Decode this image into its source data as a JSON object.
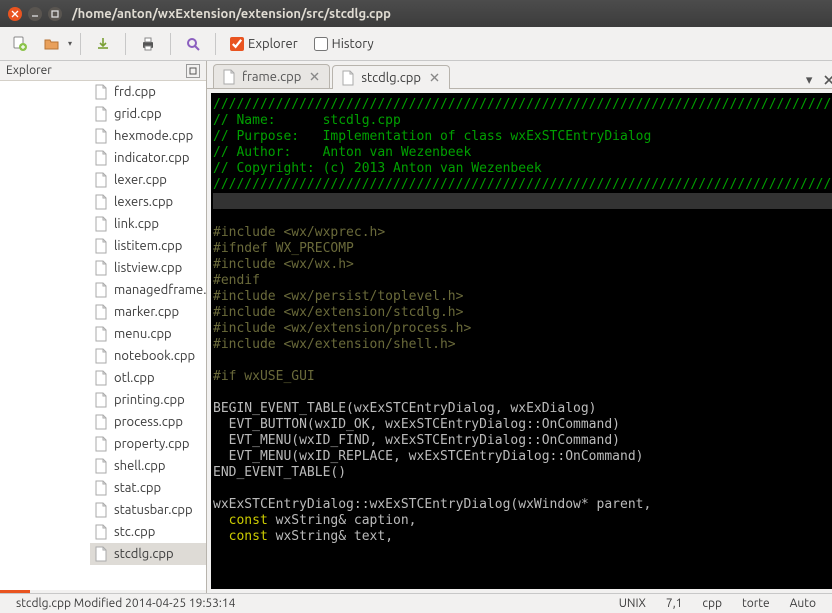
{
  "window": {
    "title": "/home/anton/wxExtension/extension/src/stcdlg.cpp"
  },
  "toolbar": {
    "explorer_label": "Explorer",
    "history_label": "History",
    "explorer_checked": true,
    "history_checked": false
  },
  "explorer": {
    "title": "Explorer",
    "files": [
      "frd.cpp",
      "grid.cpp",
      "hexmode.cpp",
      "indicator.cpp",
      "lexer.cpp",
      "lexers.cpp",
      "link.cpp",
      "listitem.cpp",
      "listview.cpp",
      "managedframe.cpp",
      "marker.cpp",
      "menu.cpp",
      "notebook.cpp",
      "otl.cpp",
      "printing.cpp",
      "process.cpp",
      "property.cpp",
      "shell.cpp",
      "stat.cpp",
      "statusbar.cpp",
      "stc.cpp",
      "stcdlg.cpp"
    ],
    "selected": "stcdlg.cpp"
  },
  "tabs": {
    "items": [
      {
        "label": "frame.cpp",
        "active": false
      },
      {
        "label": "stcdlg.cpp",
        "active": true
      }
    ]
  },
  "code": {
    "lines": [
      {
        "cls": "cm",
        "text": "////////////////////////////////////////////////////////////////////////////////"
      },
      {
        "cls": "cm",
        "text": "// Name:      stcdlg.cpp"
      },
      {
        "cls": "cm",
        "text": "// Purpose:   Implementation of class wxExSTCEntryDialog"
      },
      {
        "cls": "cm",
        "text": "// Author:    Anton van Wezenbeek"
      },
      {
        "cls": "cm",
        "text": "// Copyright: (c) 2013 Anton van Wezenbeek"
      },
      {
        "cls": "cm",
        "text": "////////////////////////////////////////////////////////////////////////////////"
      },
      {
        "cls": "hl",
        "text": " "
      },
      {
        "cls": "pp",
        "text": "#include <wx/wxprec.h>"
      },
      {
        "cls": "pp",
        "text": "#ifndef WX_PRECOMP"
      },
      {
        "cls": "pp",
        "text": "#include <wx/wx.h>"
      },
      {
        "cls": "pp",
        "text": "#endif"
      },
      {
        "cls": "pp",
        "text": "#include <wx/persist/toplevel.h>"
      },
      {
        "cls": "pp",
        "text": "#include <wx/extension/stcdlg.h>"
      },
      {
        "cls": "pp",
        "text": "#include <wx/extension/process.h>"
      },
      {
        "cls": "pp",
        "text": "#include <wx/extension/shell.h>"
      },
      {
        "cls": "",
        "text": " "
      },
      {
        "cls": "pp",
        "text": "#if wxUSE_GUI"
      },
      {
        "cls": "",
        "text": " "
      },
      {
        "cls": "",
        "text": "BEGIN_EVENT_TABLE(wxExSTCEntryDialog, wxExDialog)"
      },
      {
        "cls": "",
        "text": "  EVT_BUTTON(wxID_OK, wxExSTCEntryDialog::OnCommand)"
      },
      {
        "cls": "",
        "text": "  EVT_MENU(wxID_FIND, wxExSTCEntryDialog::OnCommand)"
      },
      {
        "cls": "",
        "text": "  EVT_MENU(wxID_REPLACE, wxExSTCEntryDialog::OnCommand)"
      },
      {
        "cls": "",
        "text": "END_EVENT_TABLE()"
      },
      {
        "cls": "",
        "text": " "
      },
      {
        "cls": "",
        "text": "wxExSTCEntryDialog::wxExSTCEntryDialog(wxWindow* parent,"
      },
      {
        "cls": "kw2",
        "text": "  const wxString& caption,"
      },
      {
        "cls": "kw2",
        "text": "  const wxString& text,"
      }
    ]
  },
  "statusbar": {
    "file": "stcdlg.cpp",
    "state": "Modified",
    "mtime": "2014-04-25 19:53:14",
    "eol": "UNIX",
    "pos": "7,1",
    "lang": "cpp",
    "theme": "torte",
    "mode": "Auto"
  }
}
